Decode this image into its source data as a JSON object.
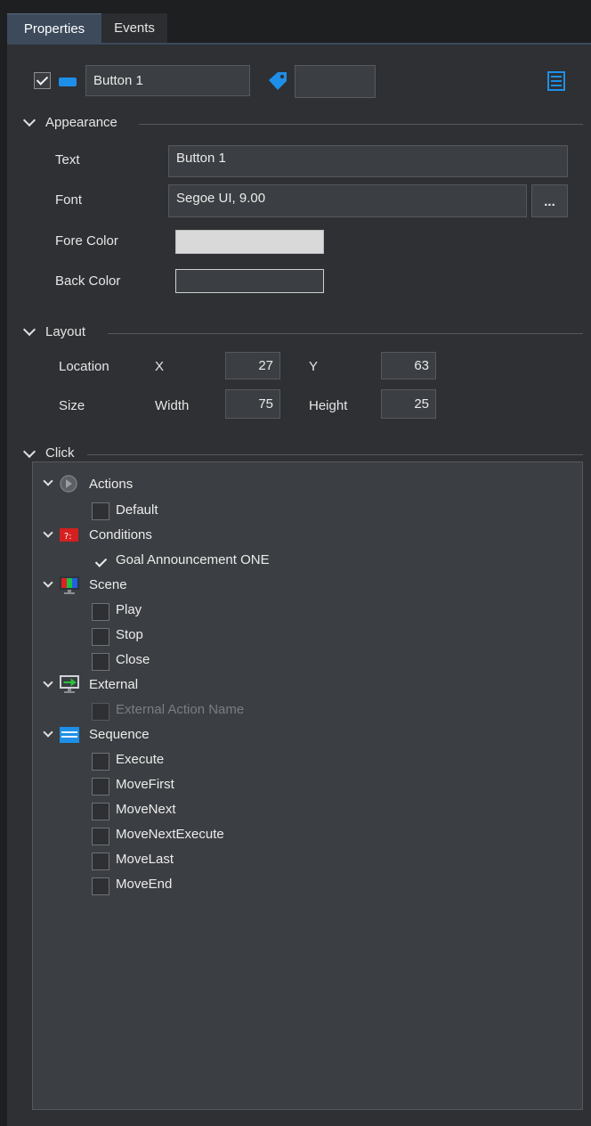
{
  "tabs": {
    "properties": "Properties",
    "events": "Events"
  },
  "header": {
    "name_value": "Button 1",
    "tag_value": ""
  },
  "appearance": {
    "title": "Appearance",
    "text_label": "Text",
    "text_value": "Button 1",
    "font_label": "Font",
    "font_value": "Segoe UI, 9.00",
    "font_button": "...",
    "fore_label": "Fore Color",
    "back_label": "Back Color",
    "fore_color": "#d9d9d9",
    "back_color": "#3b3e42"
  },
  "layout": {
    "title": "Layout",
    "location_label": "Location",
    "x_label": "X",
    "x_value": "27",
    "y_label": "Y",
    "y_value": "63",
    "size_label": "Size",
    "width_label": "Width",
    "width_value": "75",
    "height_label": "Height",
    "height_value": "25"
  },
  "click": {
    "title": "Click",
    "groups": [
      {
        "label": "Actions",
        "icon": "actions-icon",
        "items": [
          {
            "label": "Default",
            "checked": false
          }
        ]
      },
      {
        "label": "Conditions",
        "icon": "conditions-icon",
        "items": [
          {
            "label": "Goal Announcement ONE",
            "checked": true
          }
        ]
      },
      {
        "label": "Scene",
        "icon": "scene-icon",
        "items": [
          {
            "label": "Play",
            "checked": false
          },
          {
            "label": "Stop",
            "checked": false
          },
          {
            "label": "Close",
            "checked": false
          }
        ]
      },
      {
        "label": "External",
        "icon": "external-icon",
        "items": [
          {
            "label": "External Action Name",
            "checked": false,
            "disabled": true
          }
        ]
      },
      {
        "label": "Sequence",
        "icon": "sequence-icon",
        "items": [
          {
            "label": "Execute",
            "checked": false
          },
          {
            "label": "MoveFirst",
            "checked": false
          },
          {
            "label": "MoveNext",
            "checked": false
          },
          {
            "label": "MoveNextExecute",
            "checked": false
          },
          {
            "label": "MoveLast",
            "checked": false
          },
          {
            "label": "MoveEnd",
            "checked": false
          }
        ]
      }
    ]
  },
  "colors": {
    "accent": "#1e8fe8",
    "panel": "#2e3033",
    "field": "#3b3e42"
  }
}
